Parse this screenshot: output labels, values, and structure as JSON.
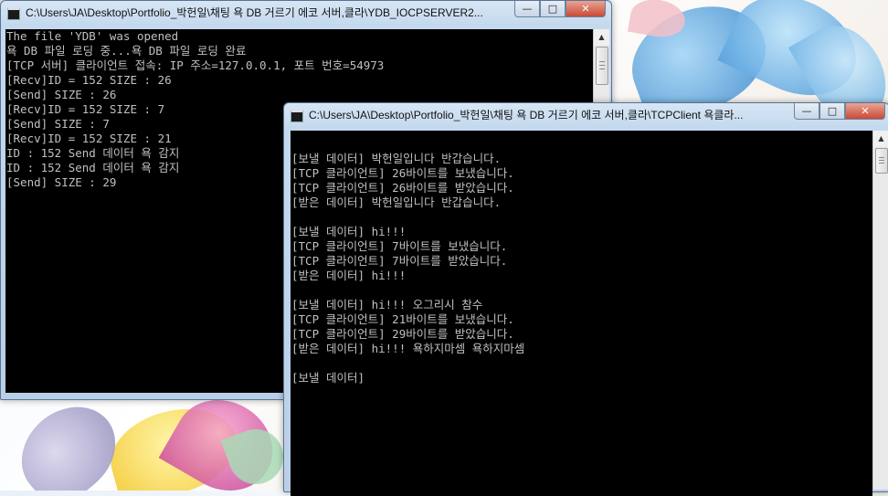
{
  "server_window": {
    "title": "C:\\Users\\JA\\Desktop\\Portfolio_박헌일\\채팅 욕 DB 거르기 에코 서버,클라\\YDB_IOCPSERVER2...",
    "controls": {
      "minimize": "—",
      "maximize": "□",
      "close": "✕"
    },
    "lines": [
      "The file 'YDB' was opened",
      "욕 DB 파일 로딩 중...욕 DB 파일 로딩 완료",
      "[TCP 서버] 클라이언트 접속: IP 주소=127.0.0.1, 포트 번호=54973",
      "[Recv]ID = 152 SIZE : 26",
      "[Send] SIZE : 26",
      "[Recv]ID = 152 SIZE : 7",
      "[Send] SIZE : 7",
      "[Recv]ID = 152 SIZE : 21",
      "ID : 152 Send 데이터 욕 감지",
      "ID : 152 Send 데이터 욕 감지",
      "[Send] SIZE : 29"
    ]
  },
  "client_window": {
    "title": "C:\\Users\\JA\\Desktop\\Portfolio_박헌일\\채팅 욕 DB 거르기 에코 서버,클라\\TCPClient 욕클라...",
    "controls": {
      "minimize": "—",
      "maximize": "□",
      "close": "✕"
    },
    "lines": [
      "",
      "[보낼 데이터] 박헌일입니다 반갑습니다.",
      "[TCP 클라이언트] 26바이트를 보냈습니다.",
      "[TCP 클라이언트] 26바이트를 받았습니다.",
      "[받은 데이터] 박헌일입니다 반갑습니다.",
      "",
      "[보낼 데이터] hi!!!",
      "[TCP 클라이언트] 7바이트를 보냈습니다.",
      "[TCP 클라이언트] 7바이트를 받았습니다.",
      "[받은 데이터] hi!!!",
      "",
      "[보낼 데이터] hi!!! 오그리시 참수",
      "[TCP 클라이언트] 21바이트를 보냈습니다.",
      "[TCP 클라이언트] 29바이트를 받았습니다.",
      "[받은 데이터] hi!!! 욕하지마셈 욕하지마셈",
      "",
      "[보낼 데이터]"
    ]
  },
  "colors": {
    "console_bg": "#000000",
    "console_text": "#c0c0c0",
    "close_button": "#c94a35",
    "titlebar": "#c5d9ee"
  },
  "icons": {
    "window_icon": "console-icon",
    "scroll_up": "arrow-up-icon",
    "scroll_down": "arrow-down-icon"
  }
}
